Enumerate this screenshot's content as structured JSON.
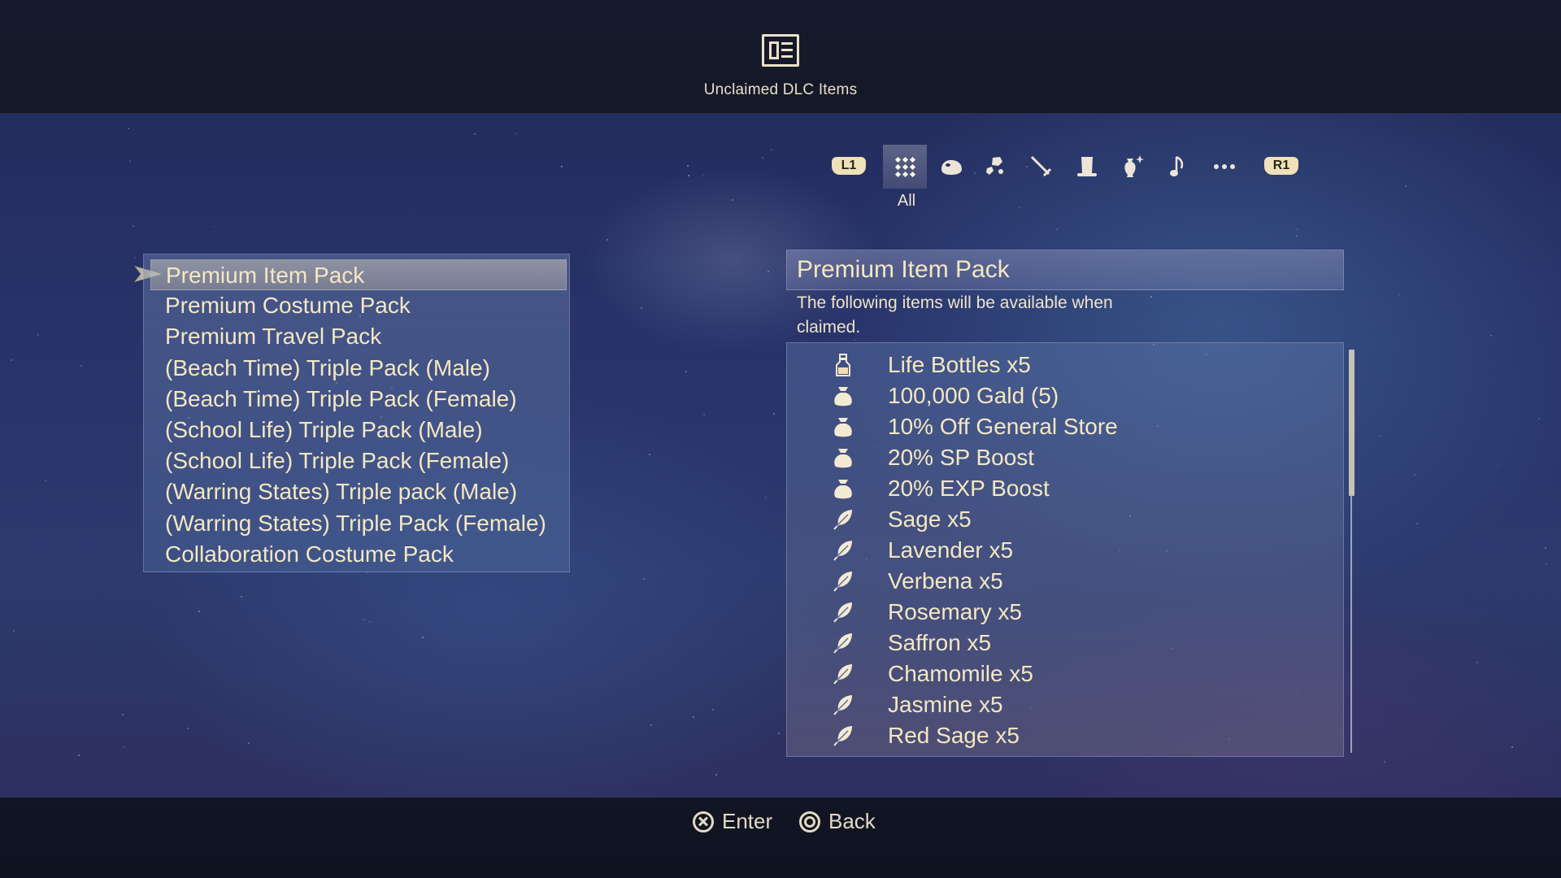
{
  "header": {
    "icon": "dlc-items-icon",
    "title": "Unclaimed DLC Items"
  },
  "category_tabs": {
    "prev_button": "L1",
    "next_button": "R1",
    "active_label": "All",
    "tabs": [
      {
        "id": "all",
        "icon": "grid-icon",
        "active": true
      },
      {
        "id": "consumables",
        "icon": "gel-icon",
        "active": false
      },
      {
        "id": "materials",
        "icon": "ore-icon",
        "active": false
      },
      {
        "id": "weapons",
        "icon": "sword-icon",
        "active": false
      },
      {
        "id": "attachments",
        "icon": "top-hat-icon",
        "active": false
      },
      {
        "id": "valuables",
        "icon": "vase-icon",
        "active": false
      },
      {
        "id": "music",
        "icon": "music-note-icon",
        "active": false
      },
      {
        "id": "other",
        "icon": "ellipsis-icon",
        "active": false
      }
    ]
  },
  "packs": {
    "selected_index": 0,
    "items": [
      "Premium Item Pack",
      "Premium Costume Pack",
      "Premium Travel Pack",
      "(Beach Time) Triple Pack (Male)",
      "(Beach Time) Triple Pack (Female)",
      "(School Life) Triple Pack (Male)",
      "(School Life) Triple Pack (Female)",
      "(Warring States) Triple pack (Male)",
      "(Warring States) Triple Pack (Female)",
      "Collaboration Costume Pack"
    ]
  },
  "detail": {
    "title": "Premium Item Pack",
    "description": "The following items will be available when claimed.",
    "items": [
      {
        "icon": "bottle-icon",
        "label": "Life Bottles x5"
      },
      {
        "icon": "pouch-icon",
        "label": "100,000 Gald (5)"
      },
      {
        "icon": "pouch-icon",
        "label": "10% Off General Store"
      },
      {
        "icon": "pouch-icon",
        "label": "20% SP Boost"
      },
      {
        "icon": "pouch-icon",
        "label": "20% EXP Boost"
      },
      {
        "icon": "leaf-icon",
        "label": "Sage x5"
      },
      {
        "icon": "leaf-icon",
        "label": "Lavender x5"
      },
      {
        "icon": "leaf-icon",
        "label": "Verbena x5"
      },
      {
        "icon": "leaf-icon",
        "label": "Rosemary x5"
      },
      {
        "icon": "leaf-icon",
        "label": "Saffron x5"
      },
      {
        "icon": "leaf-icon",
        "label": "Chamomile x5"
      },
      {
        "icon": "leaf-icon",
        "label": "Jasmine x5"
      },
      {
        "icon": "leaf-icon",
        "label": "Red Sage x5"
      }
    ],
    "scroll_fraction_visible": 0.36
  },
  "footer": {
    "enter_button": "Enter",
    "back_button": "Back"
  },
  "colors": {
    "text_cream": "#f4e7c2",
    "shoulder_badge": "#efe1b9",
    "background_navy": "#27336a"
  }
}
